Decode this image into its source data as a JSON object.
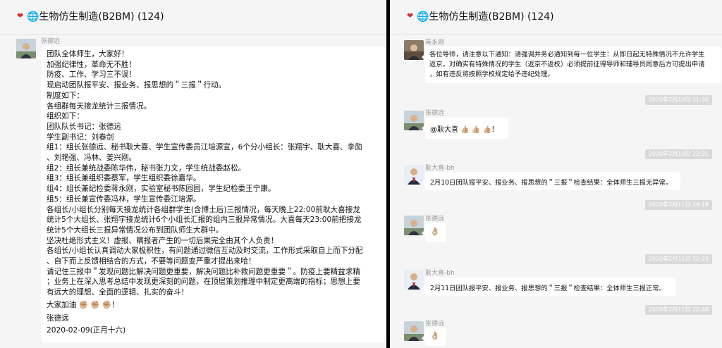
{
  "left": {
    "title": "❤️🌐生物仿生制造(B2BM) (124)",
    "title_text": "🌐生物仿生制造(B2BM) (124)",
    "message": {
      "sender": "张德远",
      "lines": [
        "团队全体师生，大家好！",
        "加强纪律性，革命无不胜！",
        "防疫、工作、学习三不误！",
        "现启动团队报平安、报业务、报思想的＂三报＂行动。",
        "制度如下：",
        "各组群每天接龙统计三报情况。",
        "组织如下：",
        "团队队长书记：张德远",
        "学生副书记：刘春剑",
        "组1：组长张德远、秘书耿大喜、学生宣传委员江培源宣，6个分小组长：张翔宇、耿大喜、李勋",
        "、刘艳强、冯林、姜兴刚。",
        "组2：组长兼统战委陈华伟，秘书张力文，学生统战委赵松。",
        "组3：组长兼组织委蔡军，学生组织委徐嘉华。",
        "组4：组长兼纪检委蒋永刚，实验室秘书陈园园，学生纪检委王宁康。",
        "组5：组长兼宣传委冯林，学生宣传委江培源。",
        "各组长/小组长分别每天接龙统计各组群学生(含博士后)三报情况，每天晚上22:00前耿大喜接龙",
        "统计5个大组长、张翔宇接龙统计6个小组长汇报的组内三报异常情况。大喜每天23:00前把接龙",
        "统计5个大组长三报异常情况公布到团队师生大群中。",
        "坚决杜绝形式主义！虚报、瞒报者产生的一切后果完全由其个人负责！",
        "各组长/小组长认真调动大家极积性，有问题通过微信互动及时交流，工作形式采取自上而下分配",
        "、自下而上反馈相结合的方式，不要等问题变严重才提出来哈！",
        "请记住三报中＂发现问题比解决问题更重要，解决问题比补救问题更重要＂。防疫上要精益求精",
        "；业务上在深入思考总结中发现更深刻的问题，在顶层策划推理中制定更高端的指标；思想上要",
        "有远大的理想、全面的逻辑、扎实的奋斗！"
      ],
      "closing": "大家加油",
      "closing_emoji": "✊🏼 ✊🏼 ✊🏼！",
      "signature": "张德远",
      "date": "2020-02-09(正月十六)"
    }
  },
  "right": {
    "title": "❤️🌐生物仿生制造(B2BM) (124)",
    "title_text": "🌐生物仿生制造(B2BM) (124)",
    "messages": [
      {
        "sender": "蒋永刚",
        "lines": [
          "各位导师，请注意以下通知：请强调并务必通知到每一位学生：从即日起无特殊情况不允许学生",
          "返京，对确实有特殊情况的学生（返京不返校）必须提前征得导师和辅导员同意后方可提出申请",
          "，如有违反将按照学校规定给予违纪处理。"
        ]
      },
      {
        "time": "2020年2月10日 11:30"
      },
      {
        "sender": "张德远",
        "text": "@耿大喜 👍🏼 👍🏼 👍🏼！"
      },
      {
        "time": "2020年2月10日 22:31"
      },
      {
        "sender": "耿大喜-bh",
        "text": "2月10日团队报平安、报业务、报思想的＂三报＂检查结果：全体师生三报无异常。"
      },
      {
        "time": "2020年2月11日 19:18"
      },
      {
        "sender": "张德远",
        "text": "👌🏼"
      },
      {
        "time": "2020年2月11日 22:23"
      },
      {
        "sender": "耿大喜-bh",
        "text": "2月11日团队报平安、报业务、报思想的＂三报＂检查结果：全体师生三报正常。"
      },
      {
        "time": "2020年2月11日 22:48"
      },
      {
        "sender": "张德远",
        "text": "👌🏼"
      }
    ]
  },
  "icons": {
    "heart": "heart-icon",
    "avatar": "user-avatar"
  },
  "colors": {
    "heart": "#d0312d",
    "timestamp_bg": "#dadada",
    "bubble": "#ffffff",
    "pane_bg": "#f5f5f5"
  }
}
